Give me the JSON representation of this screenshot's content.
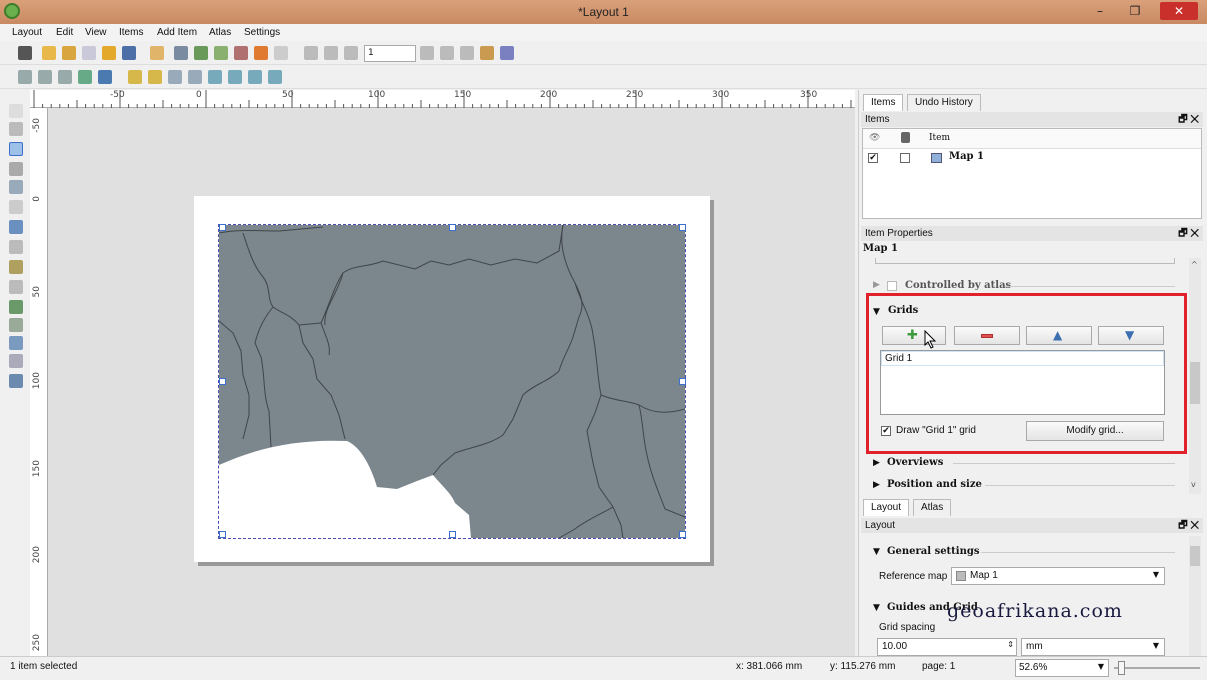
{
  "window": {
    "title": "*Layout 1",
    "minimize": "–",
    "restore": "❐",
    "close": "✕"
  },
  "menubar": [
    "Layout",
    "Edit",
    "View",
    "Items",
    "Add Item",
    "Atlas",
    "Settings"
  ],
  "toolbar": {
    "page_number": "1"
  },
  "rulers": {
    "horizontal": [
      "-50",
      "0",
      "50",
      "100",
      "150",
      "200",
      "250",
      "300",
      "350"
    ],
    "vertical": [
      "-50",
      "0",
      "50",
      "100",
      "150",
      "200",
      "250"
    ]
  },
  "items_panel": {
    "tabs": [
      "Items",
      "Undo History"
    ],
    "header": "Items",
    "column_item": "Item",
    "rows": [
      {
        "name": "Map 1",
        "visible": true,
        "locked": false
      }
    ]
  },
  "item_properties": {
    "header": "Item Properties",
    "item_name": "Map 1",
    "controlled_by_atlas": "Controlled by atlas",
    "grids_section": "Grids",
    "grid_list": [
      "Grid 1"
    ],
    "draw_grid_label": "Draw \"Grid 1\" grid",
    "modify_grid_button": "Modify grid...",
    "overviews_section": "Overviews",
    "position_size_section": "Position and size"
  },
  "layout_panel": {
    "tabs": [
      "Layout",
      "Atlas"
    ],
    "header": "Layout",
    "general_settings": "General settings",
    "reference_map_label": "Reference map",
    "reference_map_value": "Map 1",
    "guides_grid": "Guides and Grid",
    "grid_spacing_label": "Grid spacing",
    "grid_spacing_value": "10.00",
    "grid_spacing_unit": "mm"
  },
  "watermark": "geoafrikana.com",
  "statusbar": {
    "selection": "1 item selected",
    "x": "x: 381.066 mm",
    "y": "y: 115.276 mm",
    "page": "page: 1",
    "zoom": "52.6%"
  },
  "colors": {
    "map_fill": "#7b868d",
    "highlight": "#e0202a",
    "titlebar": "#d39572"
  }
}
